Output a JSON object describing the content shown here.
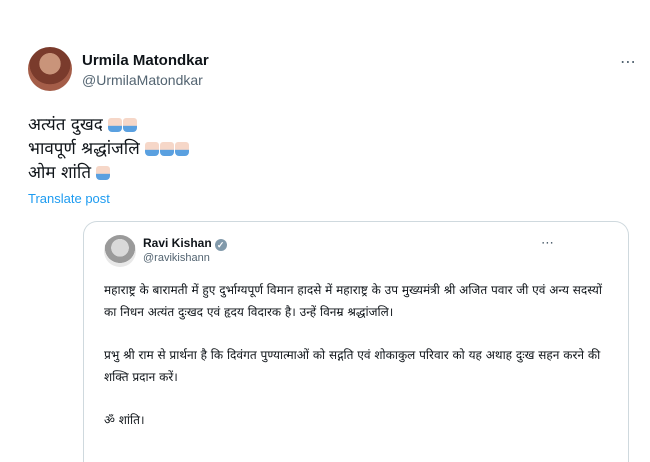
{
  "post": {
    "author_name": "Urmila Matondkar",
    "author_handle": "@UrmilaMatondkar",
    "more_icon": "⋯",
    "lines": [
      {
        "text": "अत्यंत दुखद",
        "emoji_count": 2
      },
      {
        "text": "भावपूर्ण श्रद्धांजलि",
        "emoji_count": 3
      },
      {
        "text": "ओम शांति",
        "emoji_count": 1
      }
    ],
    "emoji": "folded-hands-icon",
    "translate_label": "Translate post"
  },
  "quote": {
    "author_name": "Ravi Kishan",
    "verified_icon": "✓",
    "author_handle": "@ravikishann",
    "more_icon": "⋯",
    "paragraph1": "महाराष्ट्र के बारामती में हुए दुर्भाग्यपूर्ण विमान हादसे में महाराष्ट्र के उप मुख्यमंत्री श्री अजित पवार जी एवं अन्य सदस्यों का निधन अत्यंत दुःखद एवं हृदय विदारक है। उन्हें विनम्र श्रद्धांजलि।",
    "paragraph2": "प्रभु श्री राम से प्रार्थना है कि दिवंगत पुण्यात्माओं को सद्गति एवं शोकाकुल परिवार को यह अथाह दुःख सहन करने की शक्ति प्रदान करें।",
    "paragraph3": "ॐ शांति।"
  }
}
